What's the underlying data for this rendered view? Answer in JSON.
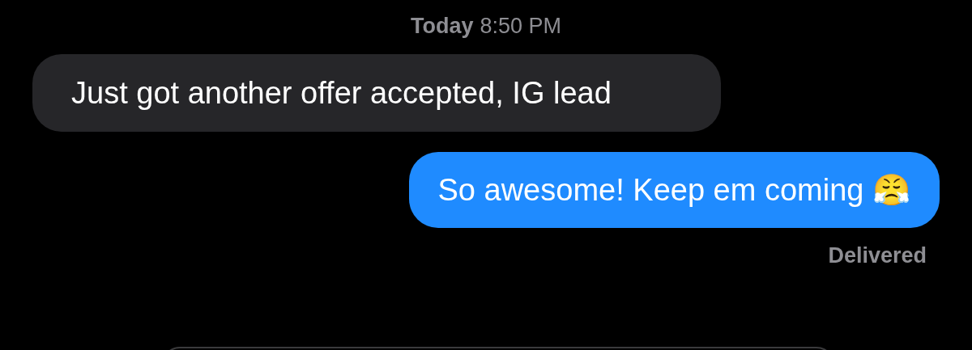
{
  "timestamp": {
    "day": "Today",
    "time": "8:50 PM"
  },
  "messages": [
    {
      "kind": "received",
      "text": "Just got another offer accepted, IG lead"
    },
    {
      "kind": "sent",
      "text": "So awesome! Keep em coming 😤"
    }
  ],
  "status": "Delivered"
}
